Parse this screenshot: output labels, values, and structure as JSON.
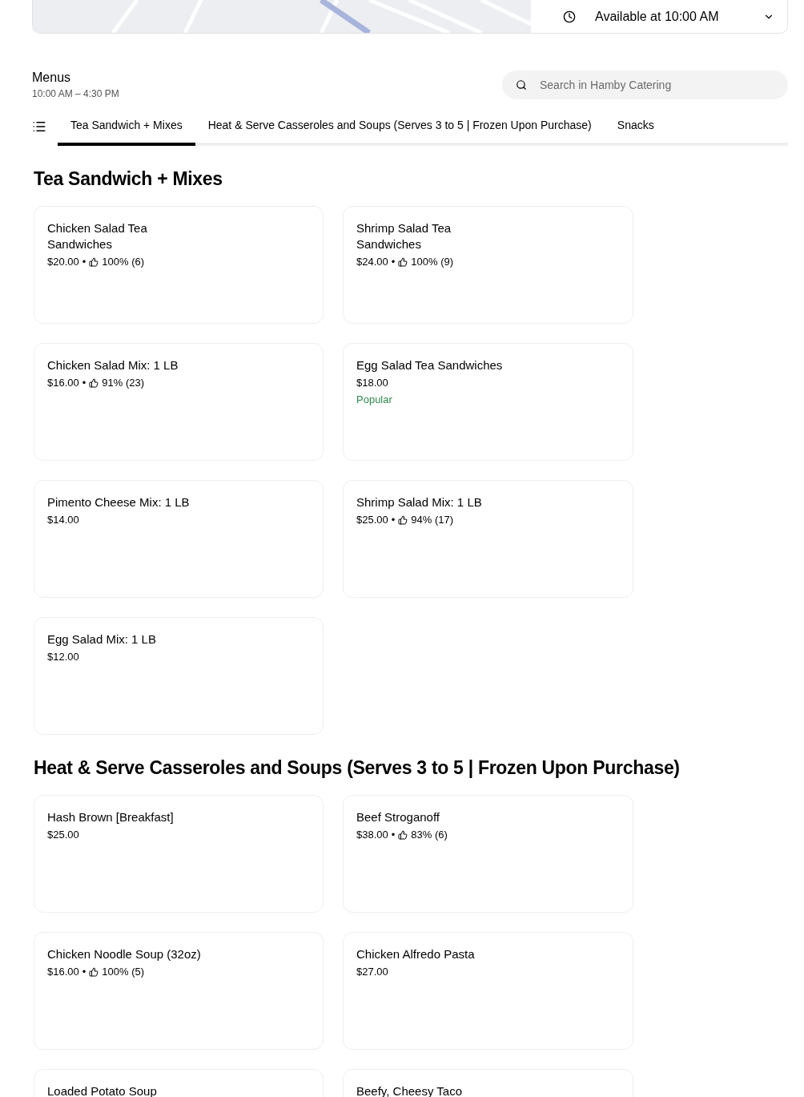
{
  "availability": {
    "label": "Available at 10:00 AM"
  },
  "menu": {
    "title": "Menus",
    "hours": "10:00 AM – 4:30 PM"
  },
  "search": {
    "placeholder": "Search in Hamby Catering"
  },
  "tabs": [
    {
      "label": "Tea Sandwich + Mixes",
      "selected": true
    },
    {
      "label": "Heat & Serve Casseroles and Soups (Serves 3 to 5 | Frozen Upon Purchase)",
      "selected": false
    },
    {
      "label": "Snacks",
      "selected": false
    }
  ],
  "sections": [
    {
      "title": "Tea Sandwich + Mixes",
      "items": [
        {
          "name": "Chicken Salad Tea Sandwiches",
          "price": "$20.00",
          "separator": "•",
          "rating": "100% (6)"
        },
        {
          "name": "Shrimp Salad Tea Sandwiches",
          "price": "$24.00",
          "separator": "•",
          "rating": "100% (9)"
        },
        {
          "name": "Chicken Salad Mix: 1 LB",
          "price": "$16.00",
          "separator": "•",
          "rating": "91% (23)"
        },
        {
          "name": "Egg Salad Tea Sandwiches",
          "price": "$18.00",
          "badge": "Popular"
        },
        {
          "name": "Pimento Cheese Mix: 1 LB",
          "price": "$14.00"
        },
        {
          "name": "Shrimp Salad Mix: 1 LB",
          "price": "$25.00",
          "separator": "•",
          "rating": "94% (17)"
        },
        {
          "name": "Egg Salad Mix: 1 LB",
          "price": "$12.00"
        }
      ]
    },
    {
      "title": "Heat & Serve Casseroles and Soups (Serves 3 to 5 | Frozen Upon Purchase)",
      "items": [
        {
          "name": "Hash Brown [Breakfast]",
          "price": "$25.00"
        },
        {
          "name": "Beef Stroganoff",
          "price": "$38.00",
          "separator": "•",
          "rating": "83% (6)"
        },
        {
          "name": "Chicken Noodle Soup (32oz)",
          "price": "$16.00",
          "separator": "•",
          "rating": "100% (5)"
        },
        {
          "name": "Chicken Alfredo Pasta",
          "price": "$27.00"
        },
        {
          "name": "Loaded Potato Soup"
        },
        {
          "name": "Beefy, Cheesy Taco"
        }
      ]
    }
  ]
}
